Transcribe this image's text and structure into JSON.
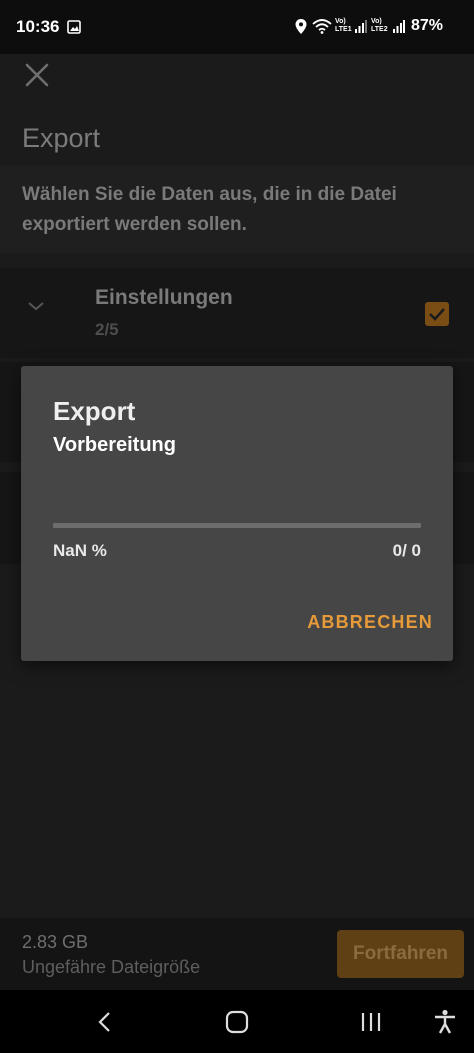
{
  "status_bar": {
    "time": "10:36",
    "battery": "87%",
    "icons": [
      "gallery-icon",
      "location-icon",
      "wifi-icon",
      "volte1-icon",
      "signal1-icon",
      "volte2-icon",
      "signal2-icon"
    ],
    "lte1": "Vo) LTE1",
    "lte2": "Vo) LTE2"
  },
  "app": {
    "title": "Export",
    "description": "Wählen Sie die Daten aus, die in die Datei exportiert werden sollen.",
    "rows": [
      {
        "title": "Einstellungen",
        "count": "2/5",
        "checked": true
      }
    ],
    "footer": {
      "size_value": "2.83 GB",
      "size_label": "Ungefähre Dateigröße",
      "continue_label": "Fortfahren"
    }
  },
  "dialog": {
    "title": "Export",
    "subtitle": "Vorbereitung",
    "progress_fraction": 0,
    "progress_percent_text": "NaN %",
    "progress_count_text": "0/ 0",
    "cancel_label": "ABBRECHEN"
  },
  "colors": {
    "accent": "#e69a3a",
    "dialog_bg": "#464646",
    "scrim_bg": "#1b1b1b"
  },
  "nav_bar": {
    "icons": [
      "back-icon",
      "home-icon",
      "recents-icon",
      "accessibility-icon"
    ]
  }
}
